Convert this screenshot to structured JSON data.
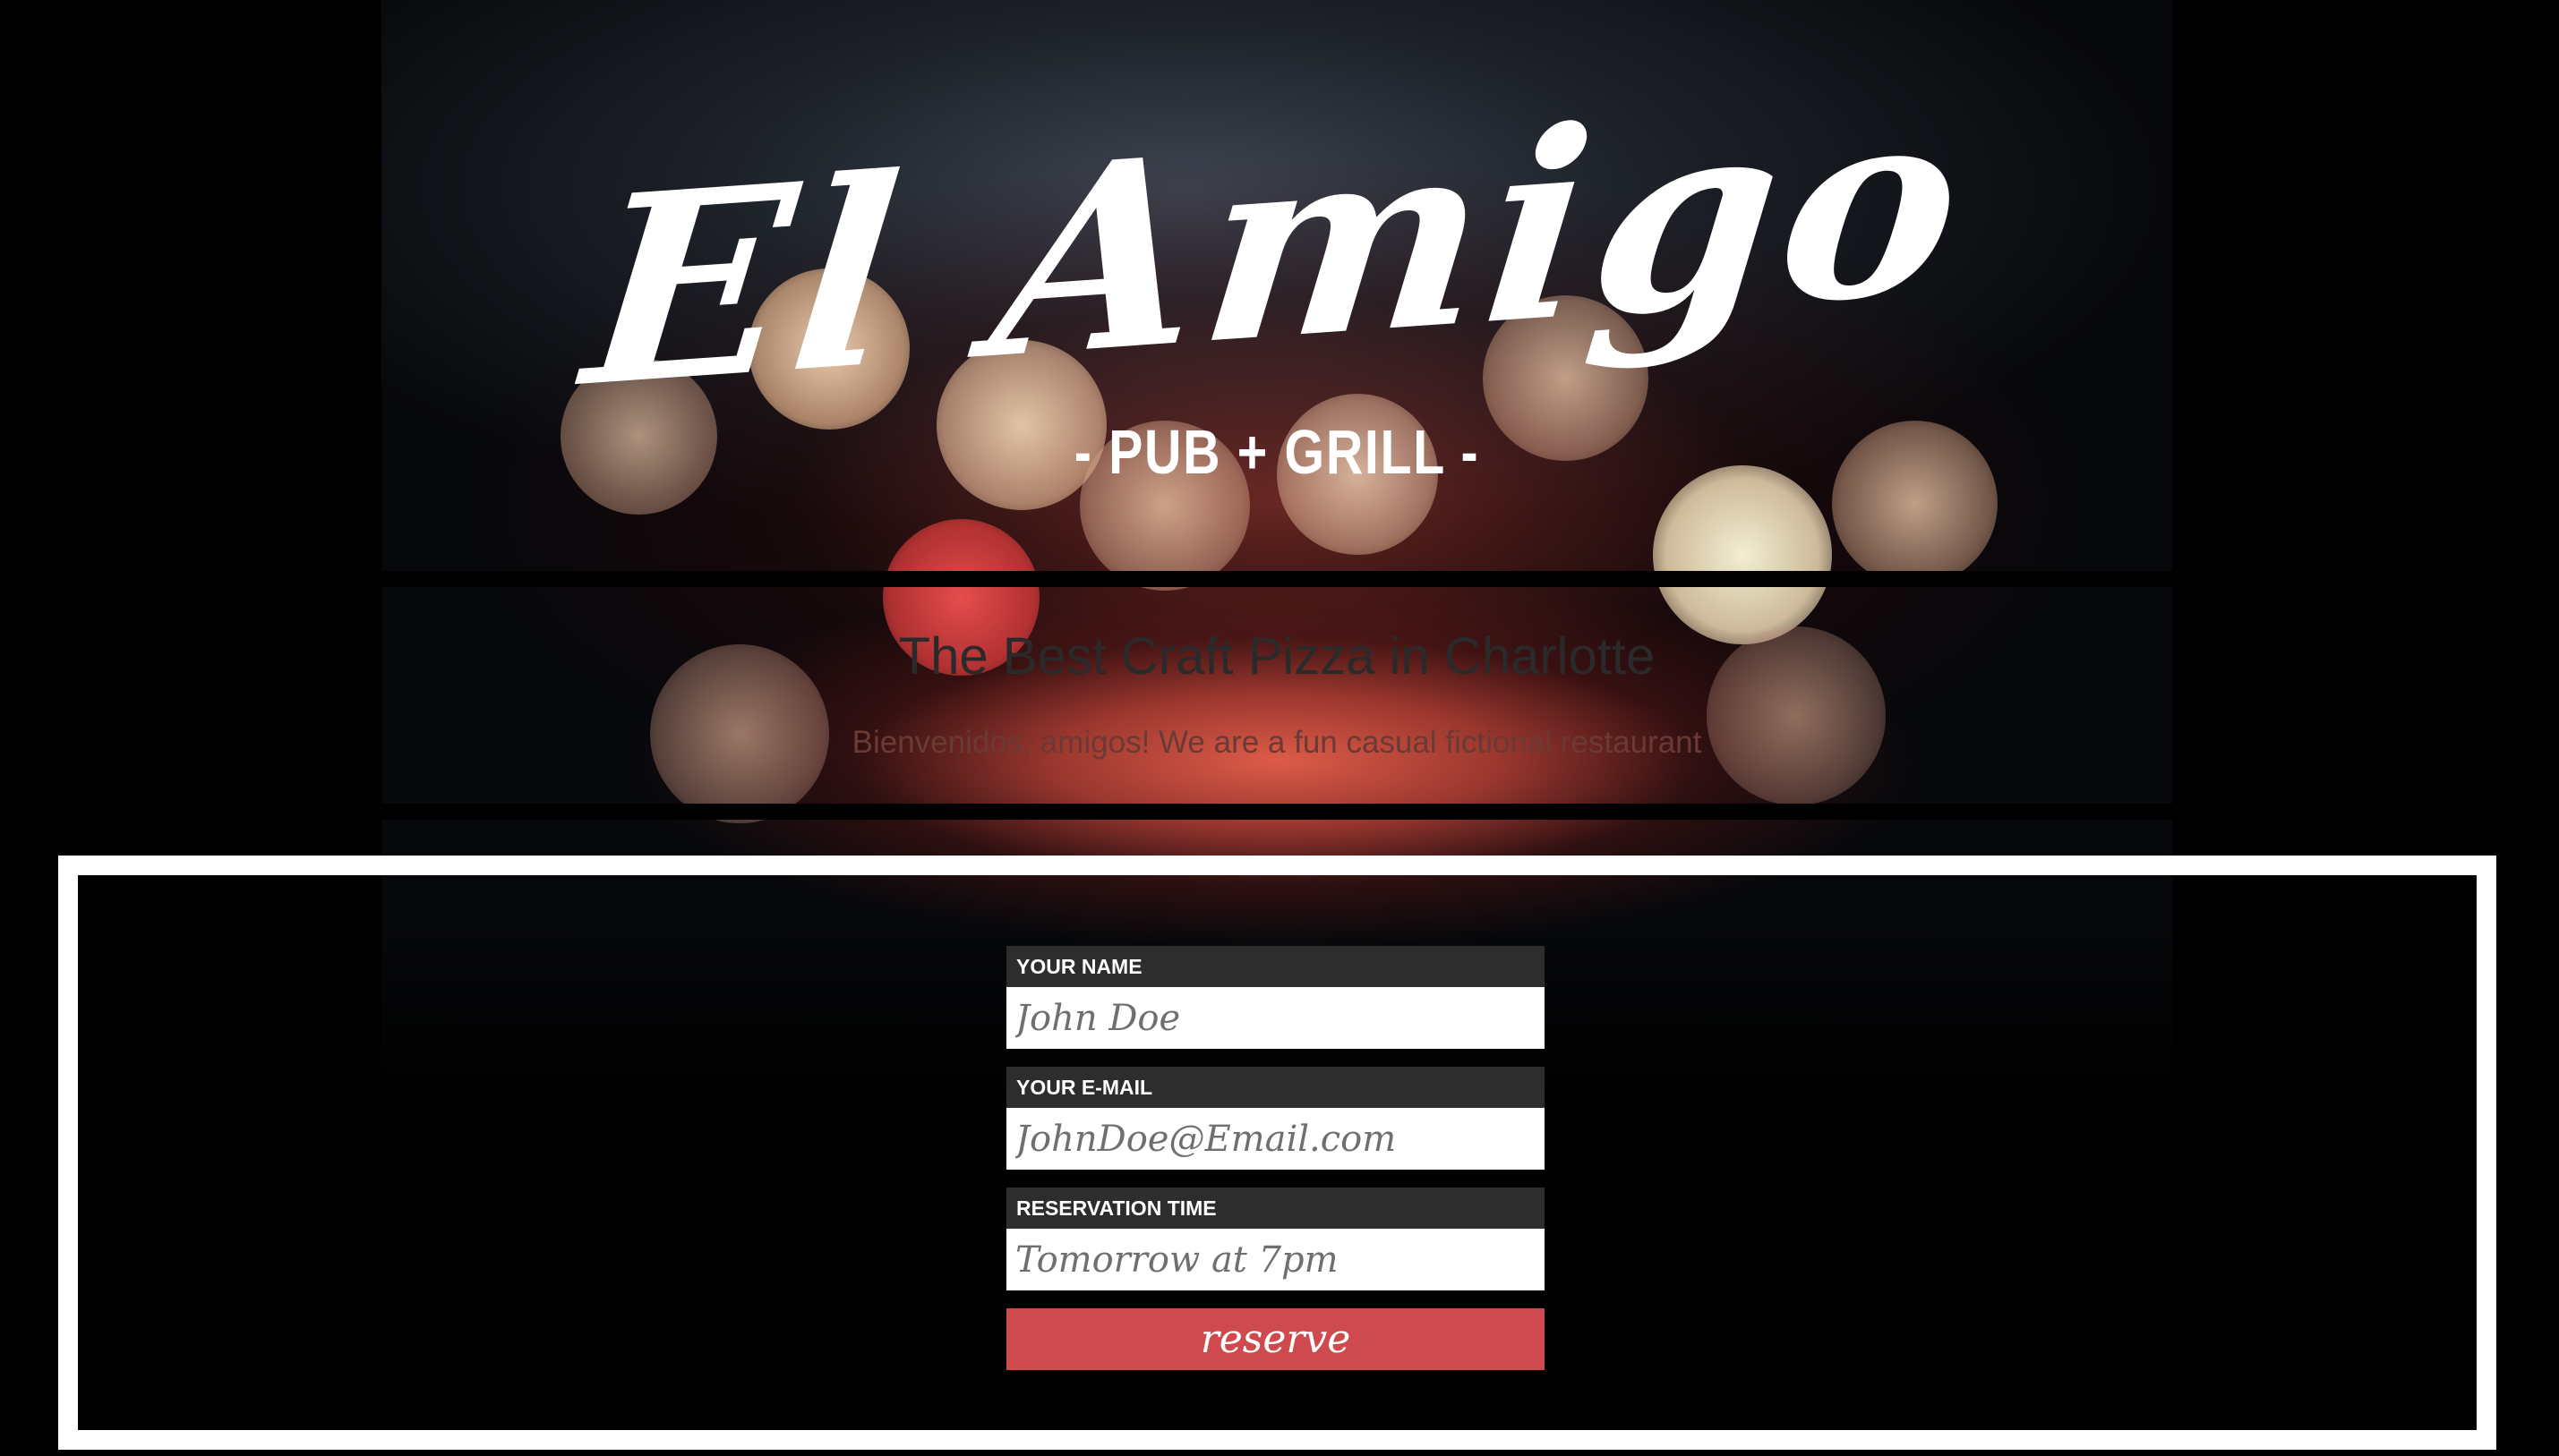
{
  "brand": {
    "logo_script": "El Amigo",
    "logo_tagline": "- PUB + GRILL -"
  },
  "intro": {
    "title": "The Best Craft Pizza in Charlotte",
    "subtitle": "Bienvenidos, amigos! We are a fun casual fictional restaurant"
  },
  "form": {
    "name": {
      "label": "YOUR NAME",
      "placeholder": "John Doe",
      "value": ""
    },
    "email": {
      "label": "YOUR E-MAIL",
      "placeholder": "JohnDoe@Email.com",
      "value": ""
    },
    "time": {
      "label": "RESERVATION TIME",
      "placeholder": "Tomorrow at 7pm",
      "value": ""
    },
    "submit_label": "reserve"
  },
  "colors": {
    "page_background": "#000000",
    "frame": "#ffffff",
    "label_background": "#2d2d2d",
    "button_accent": "#cf4a4e",
    "title_text": "#2a2a2a"
  }
}
